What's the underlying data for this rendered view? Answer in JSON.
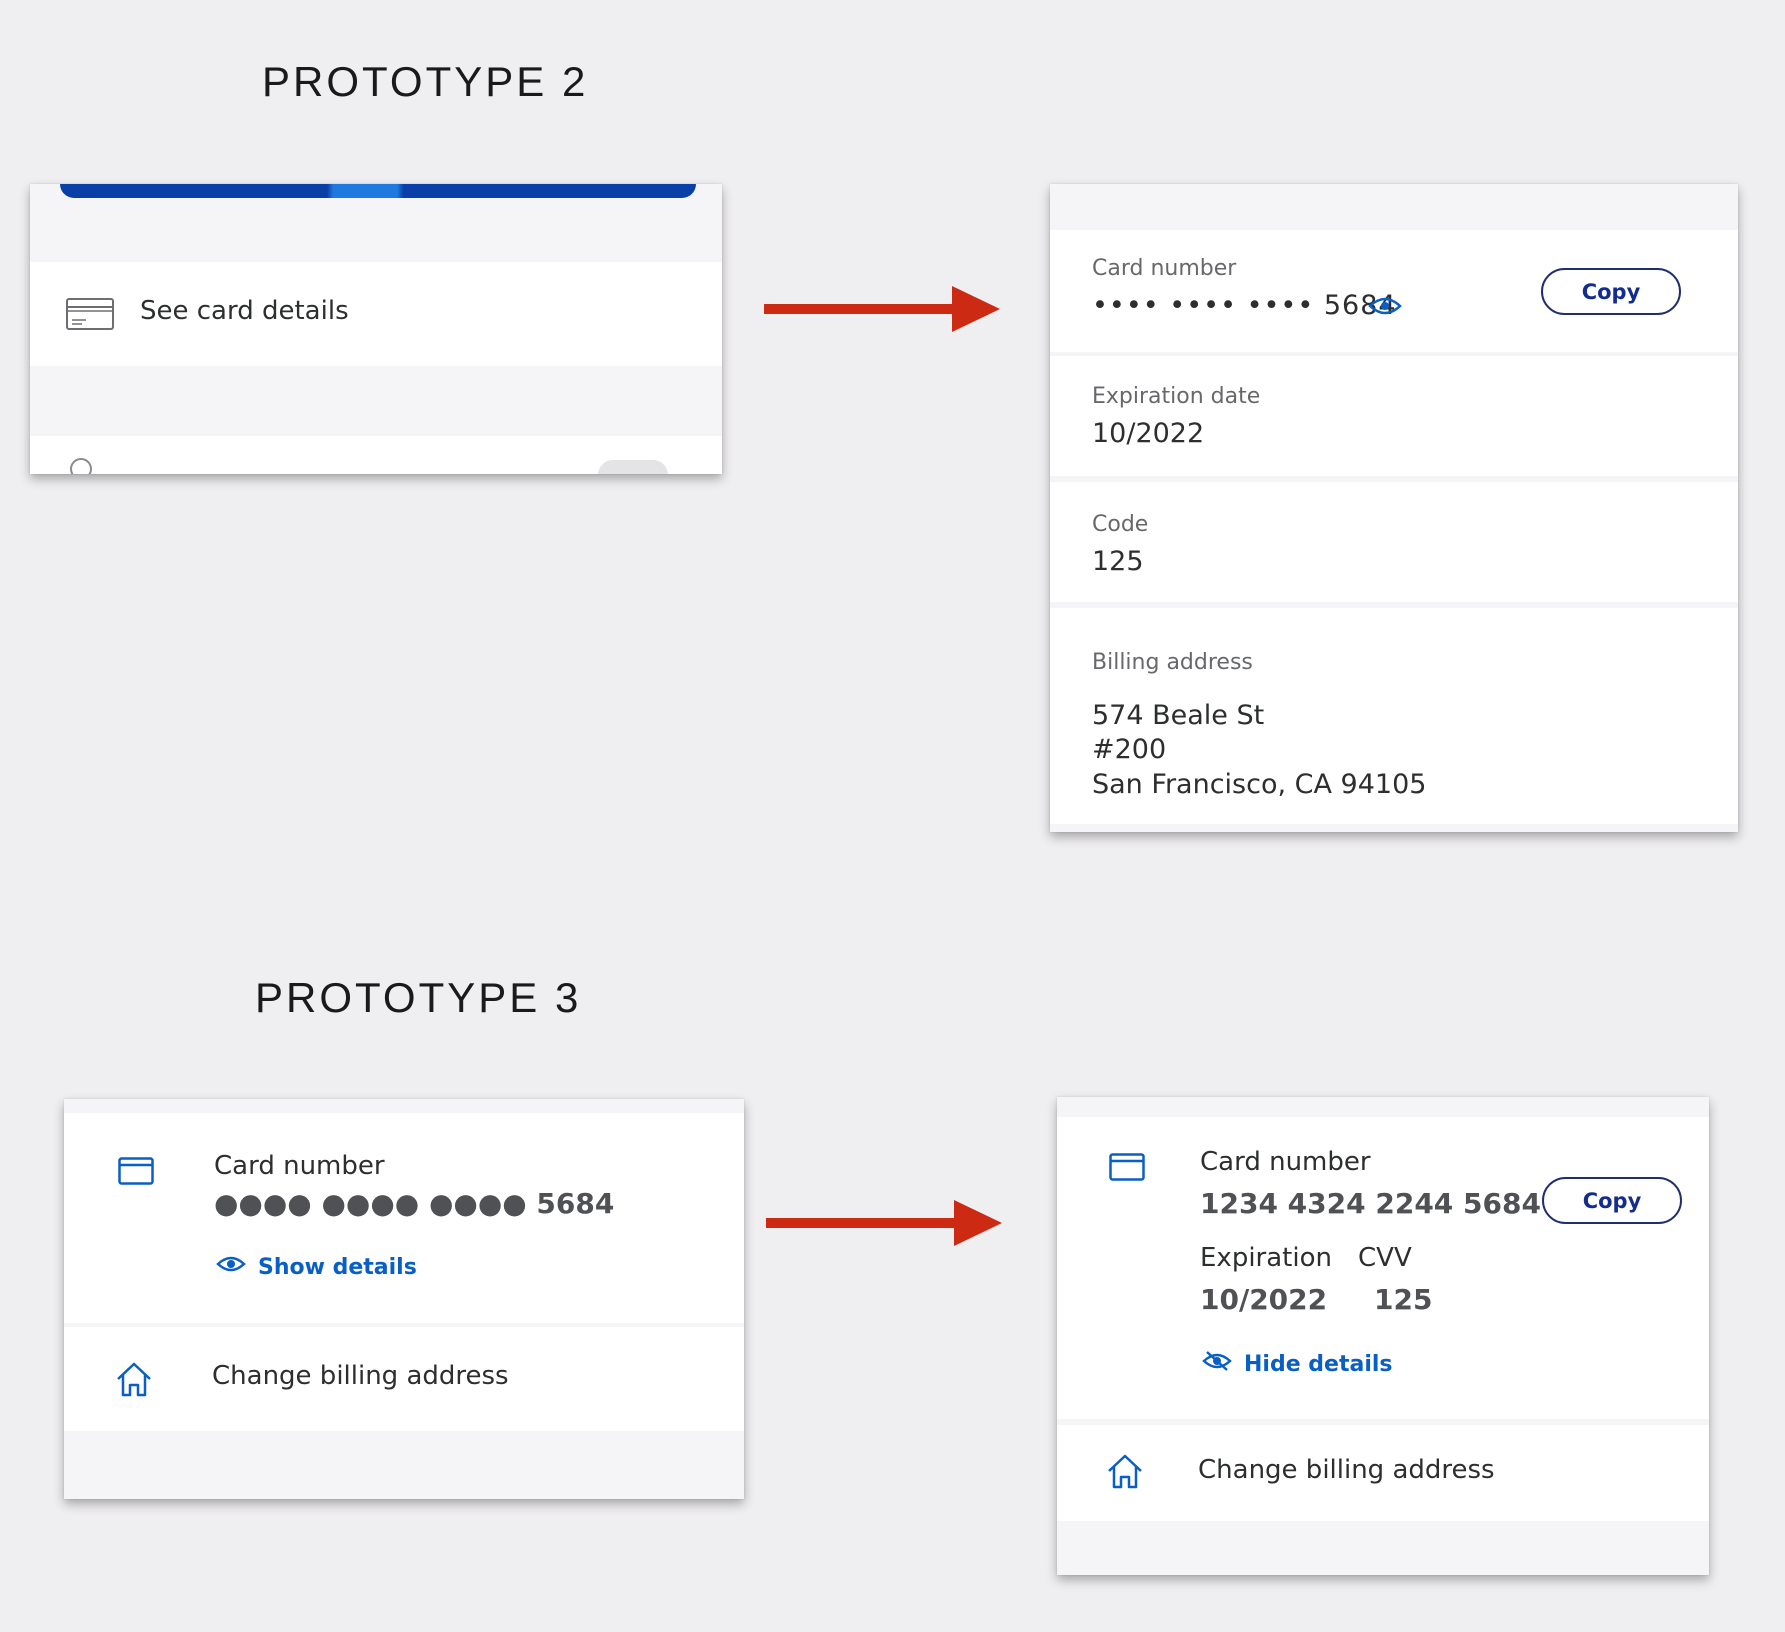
{
  "colors": {
    "background": "#efeef0",
    "arrow": "#cc2a12",
    "link_blue": "#0a5fc4",
    "button_border": "#1f2f6e",
    "card_bar": "#0b3fa8"
  },
  "prototype2": {
    "title": "PROTOTYPE 2",
    "before": {
      "card_icon": "card-outline-icon",
      "see_card_details": "See card details"
    },
    "after": {
      "card_number_label": "Card number",
      "card_number_masked": "•••• •••• •••• 5684",
      "eye_icon": "eye-icon",
      "copy_label": "Copy",
      "expiration_label": "Expiration date",
      "expiration_value": "10/2022",
      "code_label": "Code",
      "code_value": "125",
      "billing_label": "Billing address",
      "billing_line1": "574 Beale St",
      "billing_line2": "#200",
      "billing_line3": "San Francisco, CA 94105"
    }
  },
  "prototype3": {
    "title": "PROTOTYPE 3",
    "before": {
      "card_number_label": "Card number",
      "card_number_masked": "●●●● ●●●● ●●●● 5684",
      "show_details": "Show details",
      "change_billing": "Change billing address"
    },
    "after": {
      "card_number_label": "Card number",
      "card_number_full": "1234 4324 2244 5684",
      "copy_label": "Copy",
      "expiration_label": "Expiration",
      "expiration_value": "10/2022",
      "cvv_label": "CVV",
      "cvv_value": "125",
      "hide_details": "Hide details",
      "change_billing": "Change billing address"
    }
  }
}
